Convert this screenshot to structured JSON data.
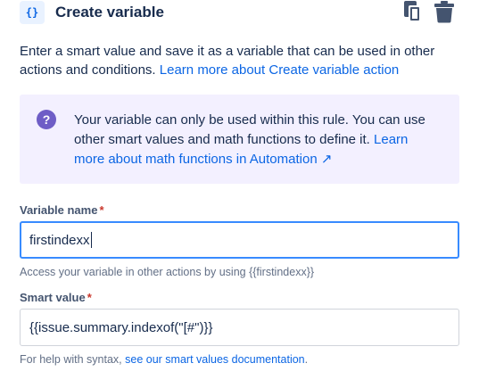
{
  "header": {
    "icon_text": "{}",
    "title": "Create variable"
  },
  "intro": {
    "text": "Enter a smart value and save it as a variable that can be used in other actions and conditions.",
    "link": "Learn more about Create variable action"
  },
  "info": {
    "icon": "?",
    "text": "Your variable can only be used within this rule. You can use other smart values and math functions to define it.",
    "link": "Learn more about math functions in Automation ↗"
  },
  "variable_name": {
    "label": "Variable name",
    "required_mark": "*",
    "value": "firstindexx",
    "helper": "Access your variable in other actions by using {{firstindexx}}"
  },
  "smart_value": {
    "label": "Smart value",
    "required_mark": "*",
    "value": "{{issue.summary.indexof(\"[#\")}}",
    "helper_prefix": "For help with syntax,",
    "helper_link": "see our smart values documentation",
    "helper_suffix": "."
  },
  "colors": {
    "link": "#0c66e4",
    "info_bg": "#f3f0ff",
    "info_icon": "#6e5dc6",
    "focus_border": "#388bff",
    "required": "#c9372c"
  }
}
